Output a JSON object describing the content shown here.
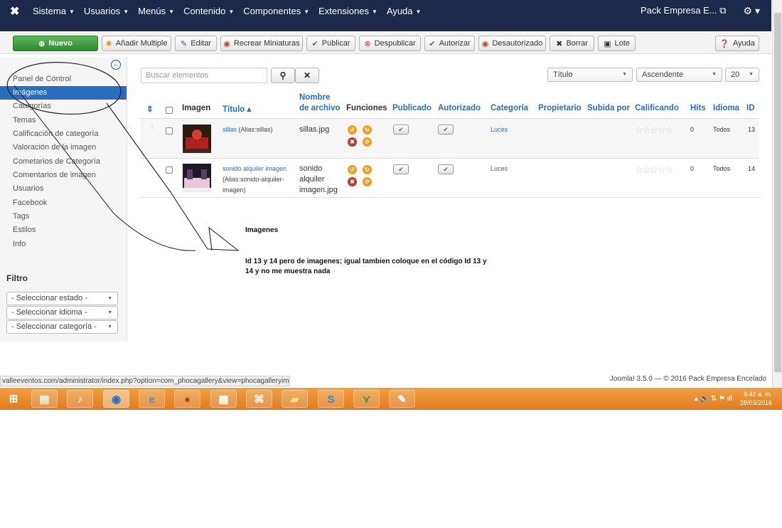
{
  "navbar": {
    "logo": "✖",
    "menus": [
      "Sistema",
      "Usuarios",
      "Menús",
      "Contenido",
      "Componentes",
      "Extensiones",
      "Ayuda"
    ],
    "site_name": "Pack Empresa E...",
    "external_icon": "external-link-icon",
    "settings_icon": "gear-icon"
  },
  "toolbar": {
    "nuevo": "Nuevo",
    "anadir_multiple": "Añadir Multiple",
    "editar": "Editar",
    "recrear": "Recrear Miniaturas",
    "publicar": "Publicar",
    "despublicar": "Despublicar",
    "autorizar": "Autorizar",
    "desautorizado": "Desautorizado",
    "borrar": "Borrar",
    "lote": "Lote",
    "ayuda": "Ayuda"
  },
  "sidebar": {
    "items": [
      {
        "label": "Panel de Control",
        "active": false
      },
      {
        "label": "Imágenes",
        "active": true
      },
      {
        "label": "Categorías",
        "active": false
      },
      {
        "label": "Temas",
        "active": false
      },
      {
        "label": "Calificación de categoría",
        "active": false
      },
      {
        "label": "Valoración de la imagen",
        "active": false
      },
      {
        "label": "Cometarios de Categoría",
        "active": false
      },
      {
        "label": "Comentarios de imagen",
        "active": false
      },
      {
        "label": "Usuarios",
        "active": false
      },
      {
        "label": "Facebook",
        "active": false
      },
      {
        "label": "Tags",
        "active": false
      },
      {
        "label": "Estilos",
        "active": false
      },
      {
        "label": "Info",
        "active": false
      }
    ],
    "filter_title": "Filtro",
    "filters": [
      "- Seleccionar estado -",
      "- Seleccionar idioma -",
      "- Seleccionar categoría -"
    ]
  },
  "list": {
    "search_placeholder": "Buscar elementos",
    "sort_field": "Título",
    "sort_dir": "Ascendente",
    "limit": "20"
  },
  "table": {
    "headers": {
      "imagen": "Imagen",
      "titulo": "Título ▴",
      "archivo_1": "Nombre",
      "archivo_2": "de archivo",
      "funciones": "Funciones",
      "publicado": "Publicado",
      "autorizado": "Autorizado",
      "categoria": "Categoría",
      "propietario": "Propietario",
      "subida": "Subida por",
      "calificando": "Calificando",
      "hits": "Hits",
      "idioma": "Idioma",
      "id": "ID"
    },
    "rows": [
      {
        "title": "sillas",
        "alias": "(Alias:sillas)",
        "filename": [
          "sillas.jpg"
        ],
        "category": "Luces",
        "hits": "0",
        "language": "Todos",
        "id": "13"
      },
      {
        "title": "sonido alquiler imagen",
        "alias": [
          "(Alias:sonido-alquiler-",
          "imagen)"
        ],
        "filename": [
          "sonido",
          "alquiler",
          "imagen.jpg"
        ],
        "category": "Luces",
        "hits": "0",
        "language": "Todos",
        "id": "14"
      }
    ],
    "stars": "☆☆☆☆☆"
  },
  "annotation": {
    "title": "Imagenes",
    "line1": "Id 13 y 14 pero de imagenes; igual tambien coloque en el código Id 13 y",
    "line2": "14 y no me muestra nada"
  },
  "statusbar": "valleeventos.com/administrator/index.php?option=com_phocagallery&view=phocagalleryimgs",
  "footer": "Joomla! 3.5.0  —  © 2016 Pack Empresa Encelado",
  "taskbar": {
    "time": "9:42 a. m.",
    "date": "28/03/2016"
  }
}
